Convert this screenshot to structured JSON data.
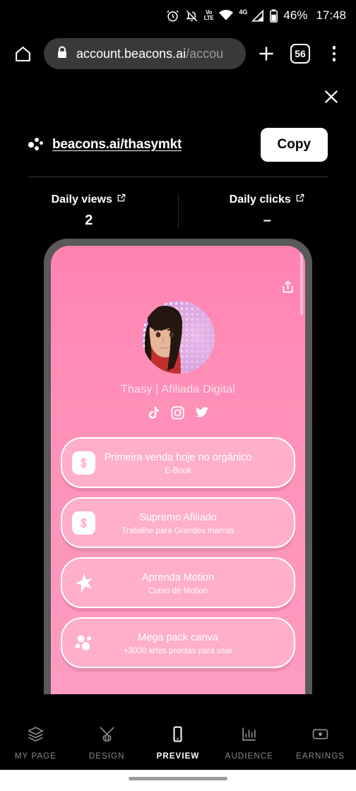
{
  "statusbar": {
    "icons": [
      "alarm-icon",
      "bell-muted-icon",
      "volte-icon",
      "wifi-icon",
      "signal-4g-icon",
      "battery-icon"
    ],
    "volte_top": "Vo",
    "volte_bottom": "LTE",
    "network": "4G",
    "battery": "46%",
    "time": "17:48"
  },
  "browser": {
    "home_icon": "home-icon",
    "lock_icon": "lock-icon",
    "url_main": "account.beacons.ai",
    "url_dim": "/accou",
    "new_tab_icon": "plus-icon",
    "tab_count": "56",
    "menu_icon": "overflow-menu-icon"
  },
  "panel": {
    "close_icon": "close-icon",
    "logo_icon": "beacons-logo-icon",
    "profile_url": "beacons.ai/thasymkt",
    "copy_label": "Copy"
  },
  "stats": [
    {
      "label": "Daily views",
      "value": "2",
      "link_icon": "external-link-icon"
    },
    {
      "label": "Daily clicks",
      "value": "–",
      "link_icon": "external-link-icon"
    }
  ],
  "preview": {
    "share_icon": "share-icon",
    "avatar_icon": "avatar",
    "display_name": "Thasy | Afiliada Digital",
    "socials": [
      "tiktok-icon",
      "instagram-icon",
      "twitter-icon"
    ],
    "links": [
      {
        "title": "Primeira venda hoje no orgânico",
        "subtitle": "E-Book",
        "icon": "dollar-icon"
      },
      {
        "title": "Supremo Afiliado",
        "subtitle": "Trabalhe para Grandes marcas",
        "icon": "dollar-icon"
      },
      {
        "title": "Aprenda Motion",
        "subtitle": "Curso de Motion",
        "icon": "star-icon"
      },
      {
        "title": "Mega pack canva",
        "subtitle": "+3000 artes prontas para usar",
        "icon": "canva-dots-icon"
      }
    ]
  },
  "bottomnav": [
    {
      "label": "MY PAGE",
      "icon": "layers-icon",
      "active": false
    },
    {
      "label": "DESIGN",
      "icon": "brushes-icon",
      "active": false
    },
    {
      "label": "PREVIEW",
      "icon": "phone-icon",
      "active": true
    },
    {
      "label": "AUDIENCE",
      "icon": "bar-chart-icon",
      "active": false
    },
    {
      "label": "EARNINGS",
      "icon": "money-icon",
      "active": false
    }
  ],
  "colors": {
    "background": "#000000",
    "phone_bezel": "#595959",
    "screen_pink": "#ff8fb8",
    "card_pink": "#ffafc9",
    "accent_white": "#ffffff"
  }
}
